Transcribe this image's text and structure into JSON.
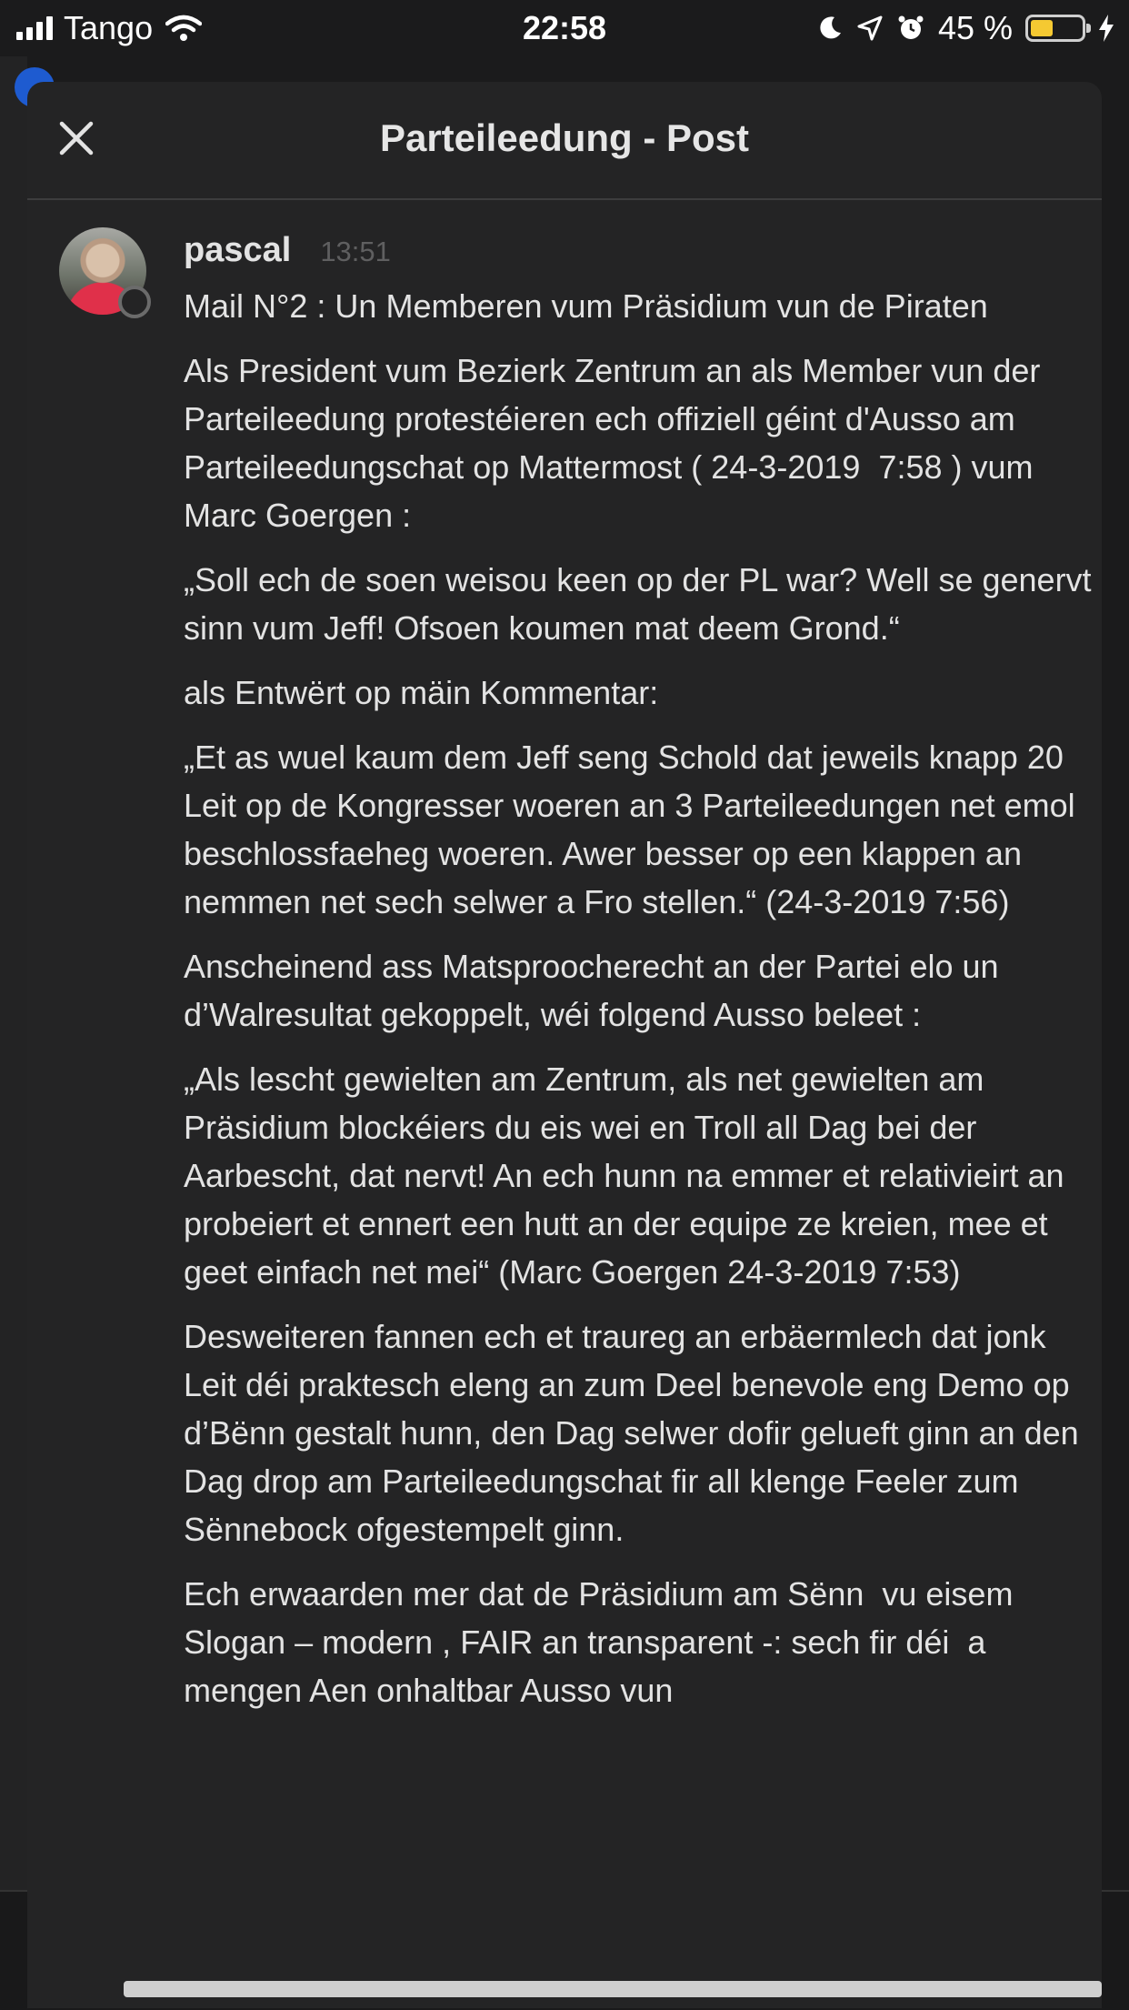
{
  "status_bar": {
    "carrier": "Tango",
    "time": "22:58",
    "battery_percent": "45 %",
    "battery_level": 0.45
  },
  "modal": {
    "title": "Parteileedung - Post"
  },
  "post": {
    "username": "pascal",
    "timestamp": "13:51",
    "paragraphs": [
      "Mail N°2 : Un Memberen vum Präsidium vun de Piraten",
      "Als President vum Bezierk Zentrum an als Member vun der Parteileedung protestéieren ech offiziell géint d'Ausso am Parteileedungschat op Mattermost ( 24-3-2019  7:58 ) vum Marc Goergen :",
      "„Soll ech de soen weisou keen op der PL war? Well se genervt sinn vum Jeff! Ofsoen koumen mat deem Grond.“",
      "als Entwërt op mäin Kommentar:",
      "„Et as wuel kaum dem Jeff seng Schold dat jeweils knapp 20 Leit op de Kongresser woeren an 3 Parteileedungen net emol beschlossfaeheg woeren. Awer besser op een klappen an nemmen net sech selwer a Fro stellen.“ (24-3-2019 7:56)",
      "Anscheinend ass Matsproocherecht an der Partei elo un d’Walresultat gekoppelt, wéi folgend Ausso beleet :",
      "„Als lescht gewielten am Zentrum, als net gewielten am Präsidium blockéiers du eis wei en Troll all Dag bei der Aarbescht, dat nervt! An ech hunn na emmer et relativieirt an probeiert et ennert een hutt an der equipe ze kreien, mee et geet einfach net mei“ (Marc Goergen 24-3-2019 7:53)",
      "Desweiteren fannen ech et traureg an erbäermlech dat jonk Leit déi praktesch eleng an zum Deel benevole eng Demo op d’Bënn gestalt hunn, den Dag selwer dofir gelueft ginn an den Dag drop am Parteileedungschat fir all klenge Feeler zum Sënnebock ofgestempelt ginn.",
      "Ech erwaarden mer dat de Präsidium am Sënn  vu eisem Slogan – modern , FAIR an transparent -: sech fir déi  a mengen Aen onhaltbar Ausso vun"
    ]
  }
}
